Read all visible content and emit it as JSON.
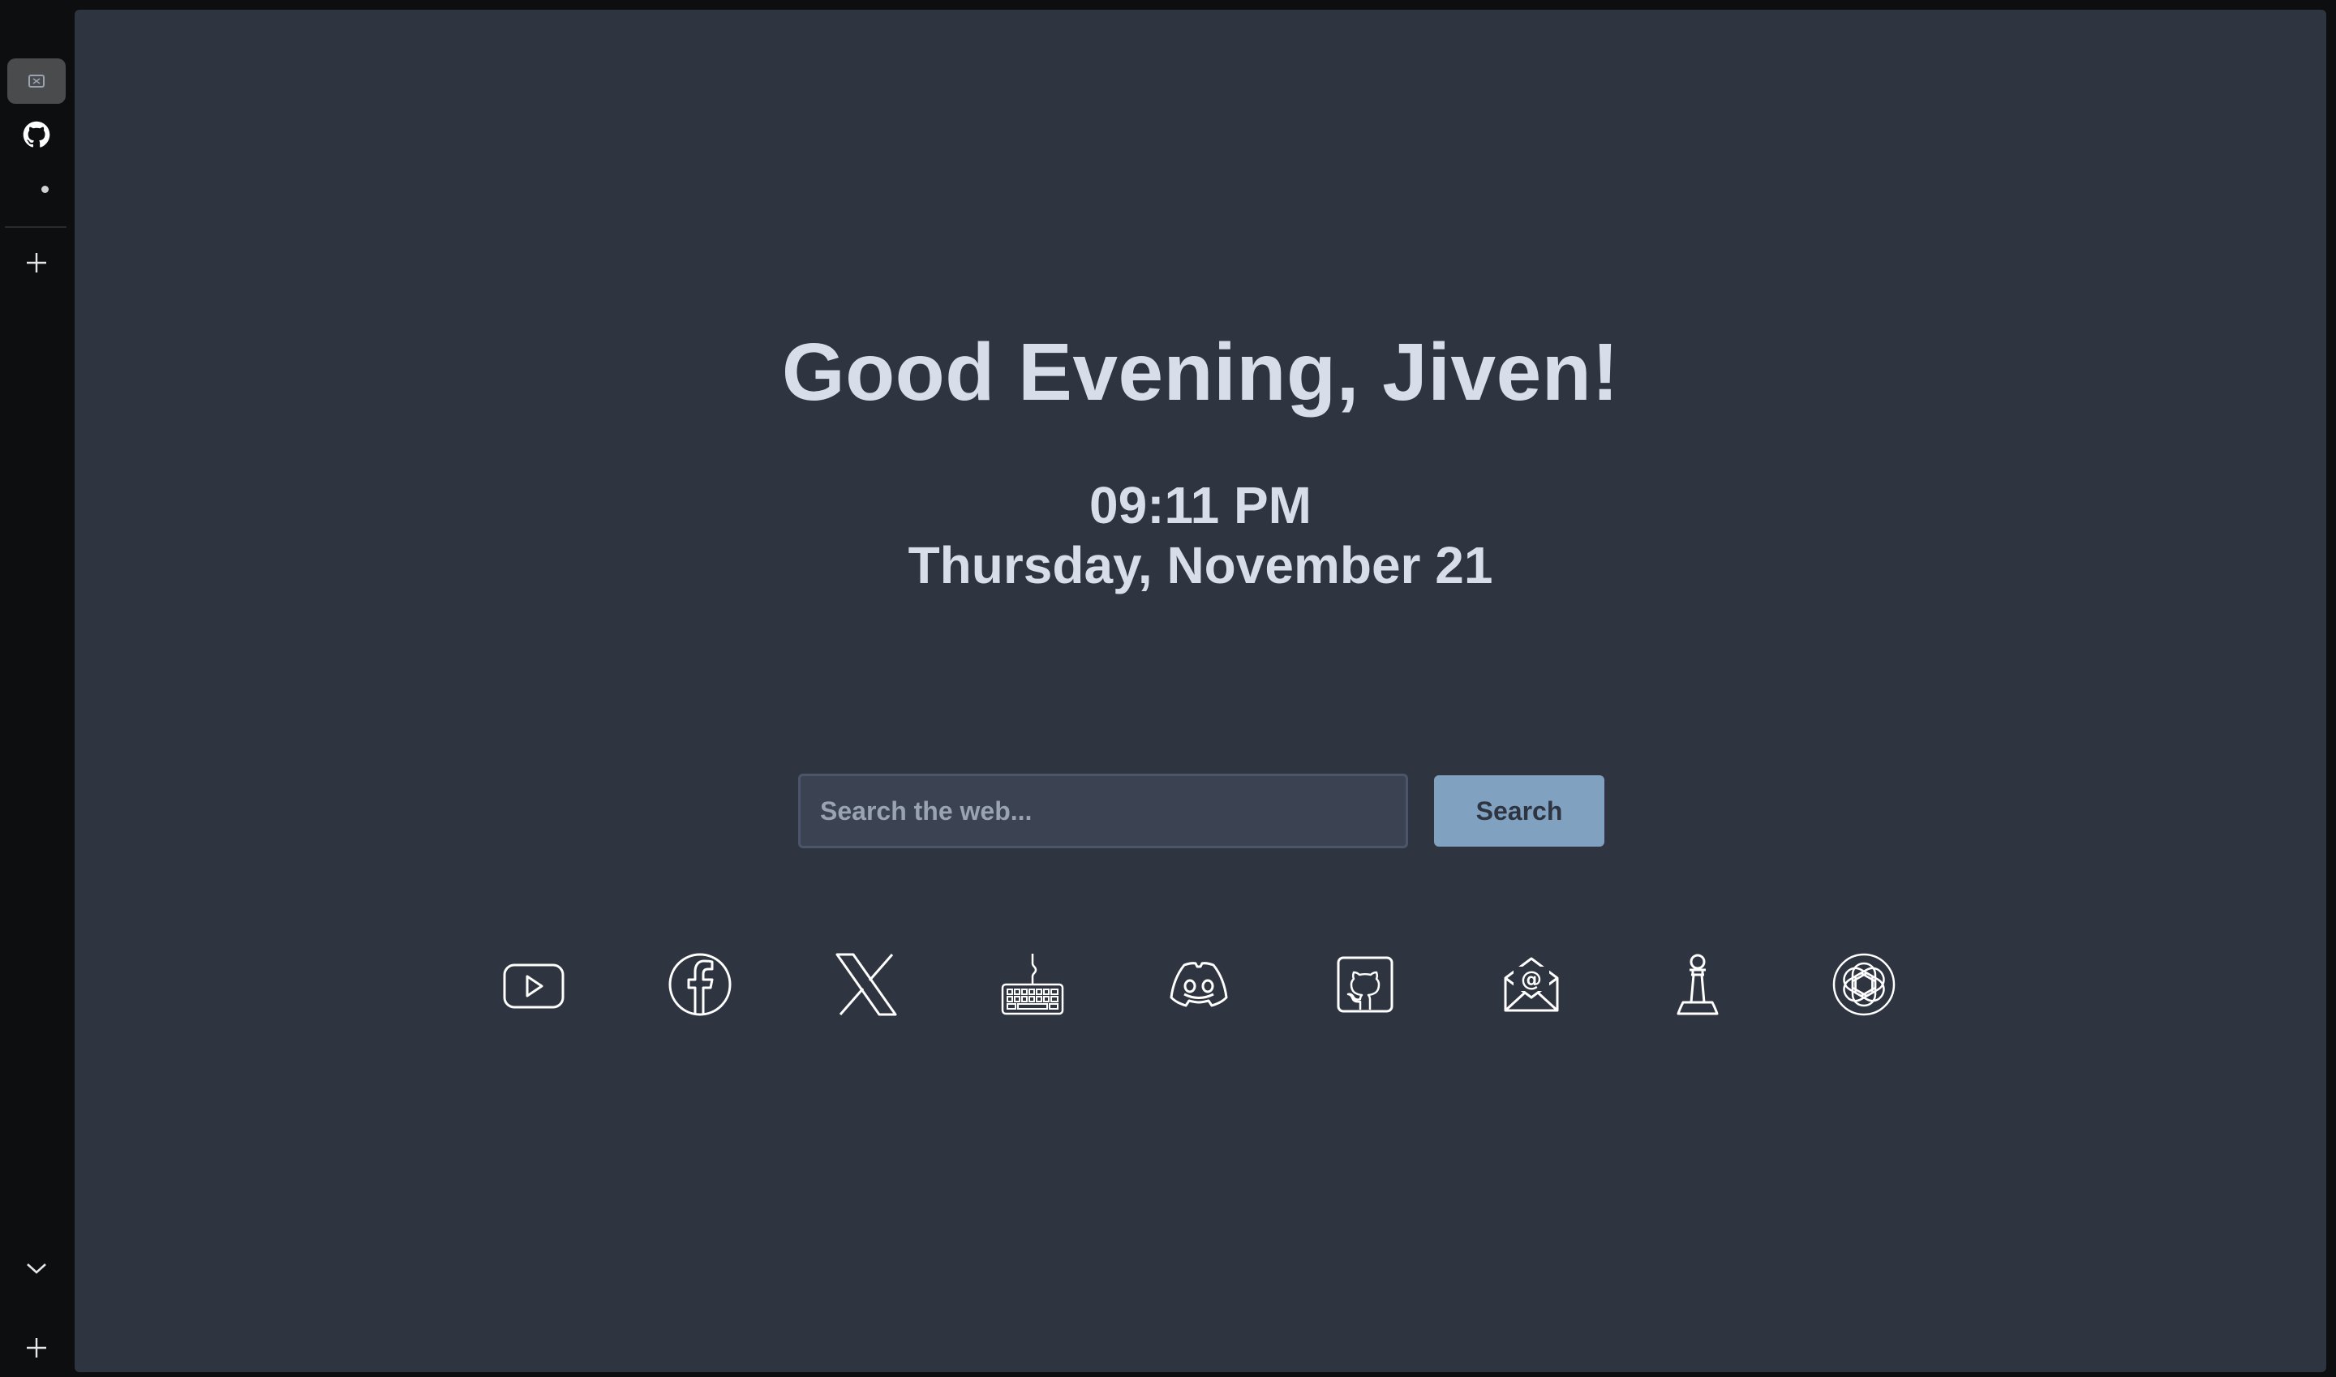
{
  "sidebar": {
    "items": [
      {
        "name": "tab-newtab",
        "icon": "newtab-icon",
        "active": true
      },
      {
        "name": "tab-github",
        "icon": "github-icon",
        "active": false
      }
    ],
    "add_icon": "plus-icon",
    "collapse_icon": "chevron-down-icon"
  },
  "greeting": "Good Evening, Jiven!",
  "clock": {
    "time": "09:11 PM",
    "date": "Thursday, November 21"
  },
  "search": {
    "placeholder": "Search the web...",
    "button_label": "Search"
  },
  "quick_links": [
    {
      "icon": "youtube-icon"
    },
    {
      "icon": "facebook-icon"
    },
    {
      "icon": "x-icon"
    },
    {
      "icon": "keyboard-icon"
    },
    {
      "icon": "discord-icon"
    },
    {
      "icon": "github-icon"
    },
    {
      "icon": "email-icon"
    },
    {
      "icon": "chess-pawn-icon"
    },
    {
      "icon": "openai-icon"
    }
  ],
  "colors": {
    "background": "#2e3440",
    "text": "#d8dee9",
    "input_bg": "#3b4252",
    "accent": "#81a1c1"
  }
}
